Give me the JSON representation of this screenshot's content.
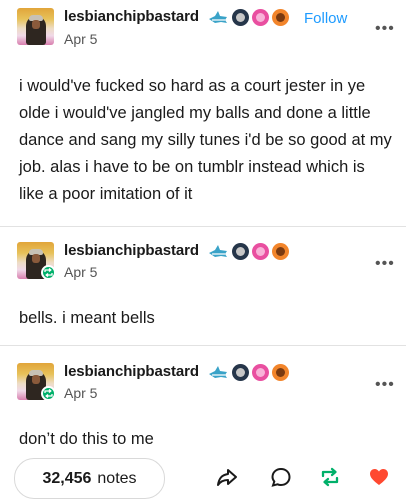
{
  "posts": [
    {
      "username": "lesbianchipbastard",
      "date": "Apr 5",
      "follow_label": "Follow",
      "menu_label": "•••",
      "text": "i would've fucked so hard as a court jester in ye olde i would've jangled my balls and done a little dance and sang my silly tunes i'd be so good at my job. alas i have to be on tumblr instead which is like a poor imitation of it"
    },
    {
      "username": "lesbianchipbastard",
      "date": "Apr 5",
      "menu_label": "•••",
      "text": "bells. i meant bells"
    },
    {
      "username": "lesbianchipbastard",
      "date": "Apr 5",
      "menu_label": "•••",
      "text": "don’t do this to me"
    }
  ],
  "footer": {
    "notes_count": "32,456",
    "notes_label": "notes"
  },
  "icons": {
    "share": "share-icon",
    "reply": "reply-icon",
    "reblog": "reblog-icon",
    "like": "heart-icon"
  },
  "colors": {
    "follow": "#1e9bff",
    "reblog": "#00b06a",
    "like": "#ff4930"
  }
}
